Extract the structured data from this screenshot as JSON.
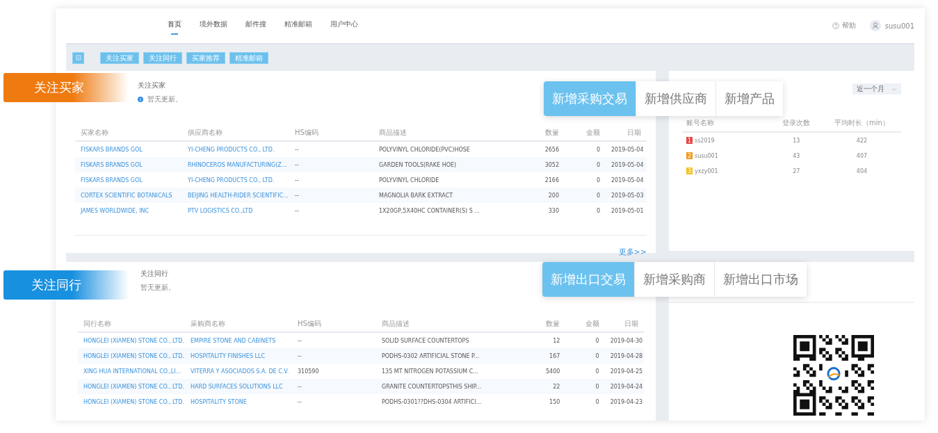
{
  "nav": {
    "tabs": [
      {
        "label": "首页",
        "selected": true
      },
      {
        "label": "境外数据",
        "selected": false
      },
      {
        "label": "邮件搜",
        "selected": false
      },
      {
        "label": "精准邮箱",
        "selected": false
      },
      {
        "label": "用户中心",
        "selected": false
      }
    ],
    "help": "帮助",
    "user": "susu001"
  },
  "toolbar": {
    "buttons": [
      "关注买家",
      "关注同行",
      "买家推荐",
      "精准邮箱"
    ]
  },
  "callouts": [
    {
      "label": "关注买家",
      "color": "#ee7a10"
    },
    {
      "label": "关注同行",
      "color": "#1890e0"
    }
  ],
  "feature_tabs": [
    [
      {
        "label": "新增采购交易",
        "selected": true
      },
      {
        "label": "新增供应商",
        "selected": false
      },
      {
        "label": "新增产品",
        "selected": false
      }
    ],
    [
      {
        "label": "新增出口交易",
        "selected": true
      },
      {
        "label": "新增采购商",
        "selected": false
      },
      {
        "label": "新增出口市场",
        "selected": false
      }
    ]
  ],
  "buyers": {
    "title": "关注买家",
    "note": "暂无更新。",
    "columns": [
      "买家名称",
      "供应商名称",
      "HS编码",
      "商品描述",
      "数量",
      "金额",
      "日期"
    ],
    "rows": [
      [
        "FISKARS BRANDS GOL",
        "YI-CHENG PRODUCTS CO., LTD.",
        "--",
        "POLYVINYL CHLORIDE(PVC)HOSE",
        "2656",
        "0",
        "2019-05-04"
      ],
      [
        "FISKARS BRANDS GOL",
        "RHINOCEROS MANUFACTURING(Z...",
        "--",
        "GARDEN TOOLS(RAKE HOE)",
        "3052",
        "0",
        "2019-05-04"
      ],
      [
        "FISKARS BRANDS GOL",
        "YI-CHENG PRODUCTS CO., LTD.",
        "--",
        "POLYVINYL CHLORIDE",
        "2166",
        "0",
        "2019-05-04"
      ],
      [
        "CORTEX SCIENTIFIC BOTANICALS",
        "BEIJING HEALTH-RIDER SCIENTIFIC...",
        "--",
        "MAGNOLIA BARK EXTRACT",
        "200",
        "0",
        "2019-05-03"
      ],
      [
        "JAMES WORLDWIDE, INC",
        "PTV LOGISTICS CO.,LTD",
        "--",
        "1X20GP,5X40HC CONTAINER(S) S ...",
        "330",
        "0",
        "2019-05-01"
      ]
    ],
    "more": "更多>>"
  },
  "peers": {
    "title": "关注同行",
    "note": "暂无更新。",
    "columns": [
      "同行名称",
      "采购商名称",
      "HS编码",
      "商品描述",
      "数量",
      "金额",
      "日期"
    ],
    "rows": [
      [
        "HONGLEI (XIAMEN) STONE CO., LTD.",
        "EMPIRE STONE AND CABINETS",
        "--",
        "SOLID SURFACE COUNTERTOPS",
        "12",
        "0",
        "2019-04-30"
      ],
      [
        "HONGLEI (XIAMEN) STONE CO., LTD.",
        "HOSPITALITY FINISHES LLC",
        "--",
        "PODHS-0302 ARTIFICIAL STONE P...",
        "167",
        "0",
        "2019-04-28"
      ],
      [
        "XING HUA INTERNATIONAL CO.,LI...",
        "VITERRA Y ASOCIADOS S.A. DE C.V.",
        "310590",
        "135 MT NITROGEN POTASSIUM C...",
        "5400",
        "0",
        "2019-04-25"
      ],
      [
        "HONGLEI (XIAMEN) STONE CO., LTD.",
        "HARD SURFACES SOLUTIONS LLC",
        "--",
        "GRANITE COUNTERTOPSTHIS SHIP...",
        "22",
        "0",
        "2019-04-24"
      ],
      [
        "HONGLEI (XIAMEN) STONE CO., LTD.",
        "HOSPITALITY STONE",
        "--",
        "PODHS-0301??DHS-0304 ARTIFICI...",
        "150",
        "0",
        "2019-04-23"
      ]
    ]
  },
  "logins": {
    "period": "近一个月",
    "columns": [
      "账号名称",
      "登录次数",
      "平均时长（min）"
    ],
    "rows": [
      {
        "rank": "1",
        "color": "#e84545",
        "name": "ss2019",
        "count": "13",
        "avg": "422"
      },
      {
        "rank": "2",
        "color": "#f29a1a",
        "name": "susu001",
        "count": "43",
        "avg": "407"
      },
      {
        "rank": "3",
        "color": "#f7c21b",
        "name": "yxzy001",
        "count": "27",
        "avg": "404"
      }
    ]
  }
}
